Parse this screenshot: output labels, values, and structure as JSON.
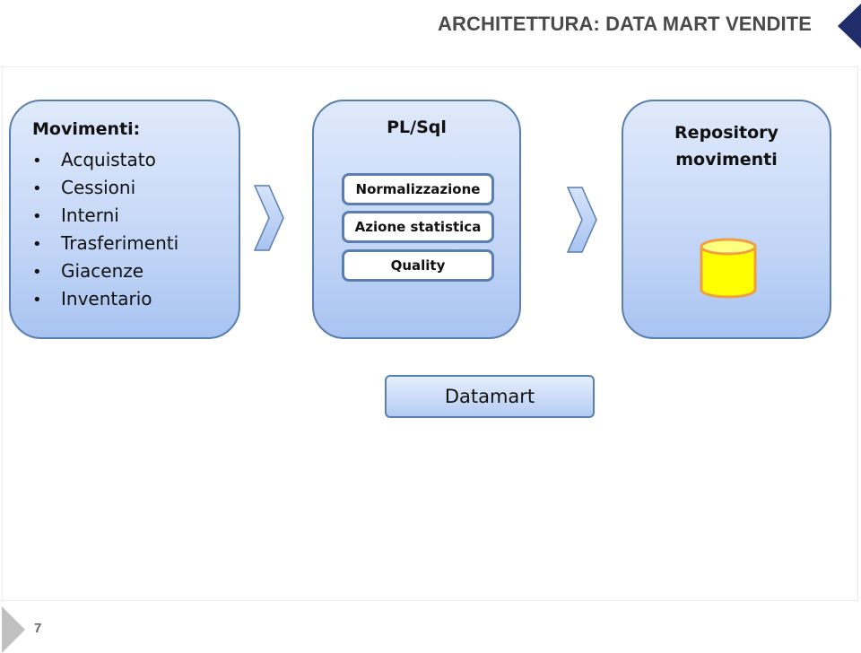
{
  "slide": {
    "title": "ARCHITETTURA: DATA MART VENDITE",
    "page_number": "7",
    "accent_color": "#1f2d6b"
  },
  "sources": {
    "heading": "Movimenti:",
    "bullet": "•",
    "items": [
      "Acquistato",
      "Cessioni",
      "Interni",
      "Trasferimenti",
      "Giacenze",
      "Inventario"
    ]
  },
  "processing": {
    "heading": "PL/Sql",
    "steps": [
      "Normalizzazione",
      "Azione statistica",
      "Quality"
    ]
  },
  "repository": {
    "heading_line1": "Repository",
    "heading_line2": "movimenti",
    "icon": "database-icon"
  },
  "output": {
    "label": "Datamart"
  },
  "flow": {
    "arrows": [
      "chevron-right-icon",
      "chevron-right-icon"
    ]
  }
}
